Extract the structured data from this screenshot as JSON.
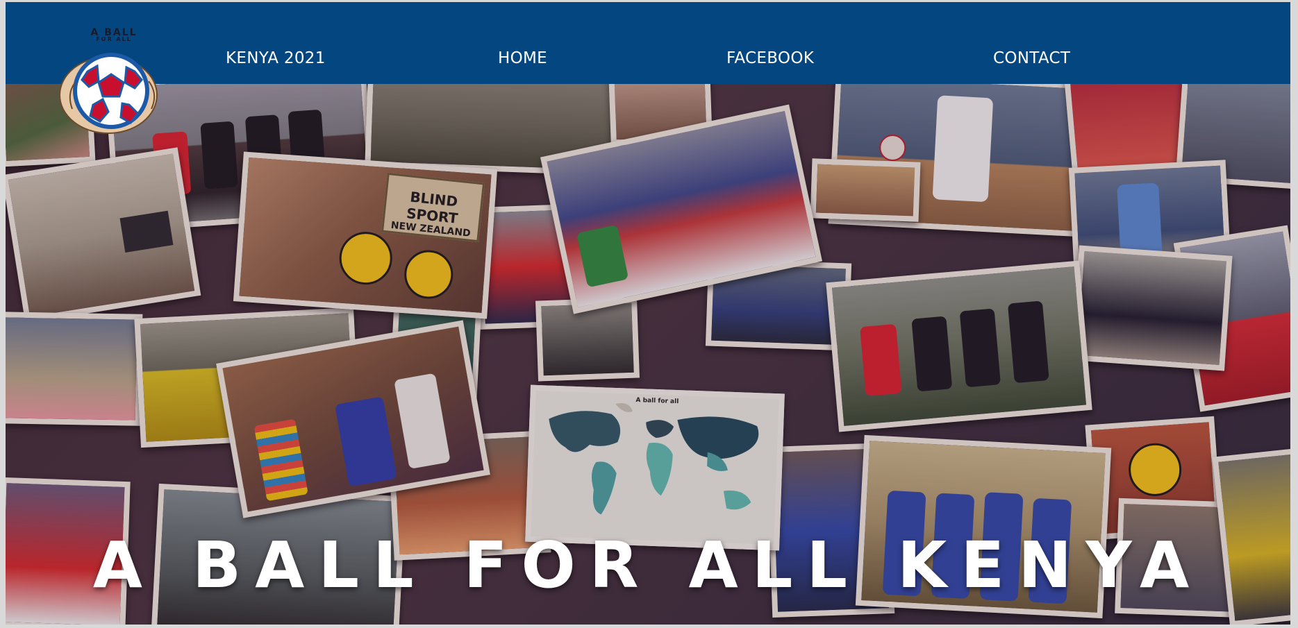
{
  "logo": {
    "text_top": "A BALL",
    "text_sub": "FOR ALL"
  },
  "nav": {
    "items": [
      {
        "label": "KENYA 2021"
      },
      {
        "label": "HOME"
      },
      {
        "label": "FACEBOOK"
      },
      {
        "label": "CONTACT"
      }
    ]
  },
  "collage": {
    "sign_line1": "BLIND SPORT",
    "sign_line2": "NEW ZEALAND",
    "map_caption": "A ball for all"
  },
  "hero": {
    "title": "A BALL FOR ALL KENYA"
  },
  "colors": {
    "navbar": "#034680",
    "nav_text": "#ffffff",
    "hero_text": "#ffffff",
    "logo_ring": "#1c5aa8",
    "logo_patch": "#c8102e"
  }
}
